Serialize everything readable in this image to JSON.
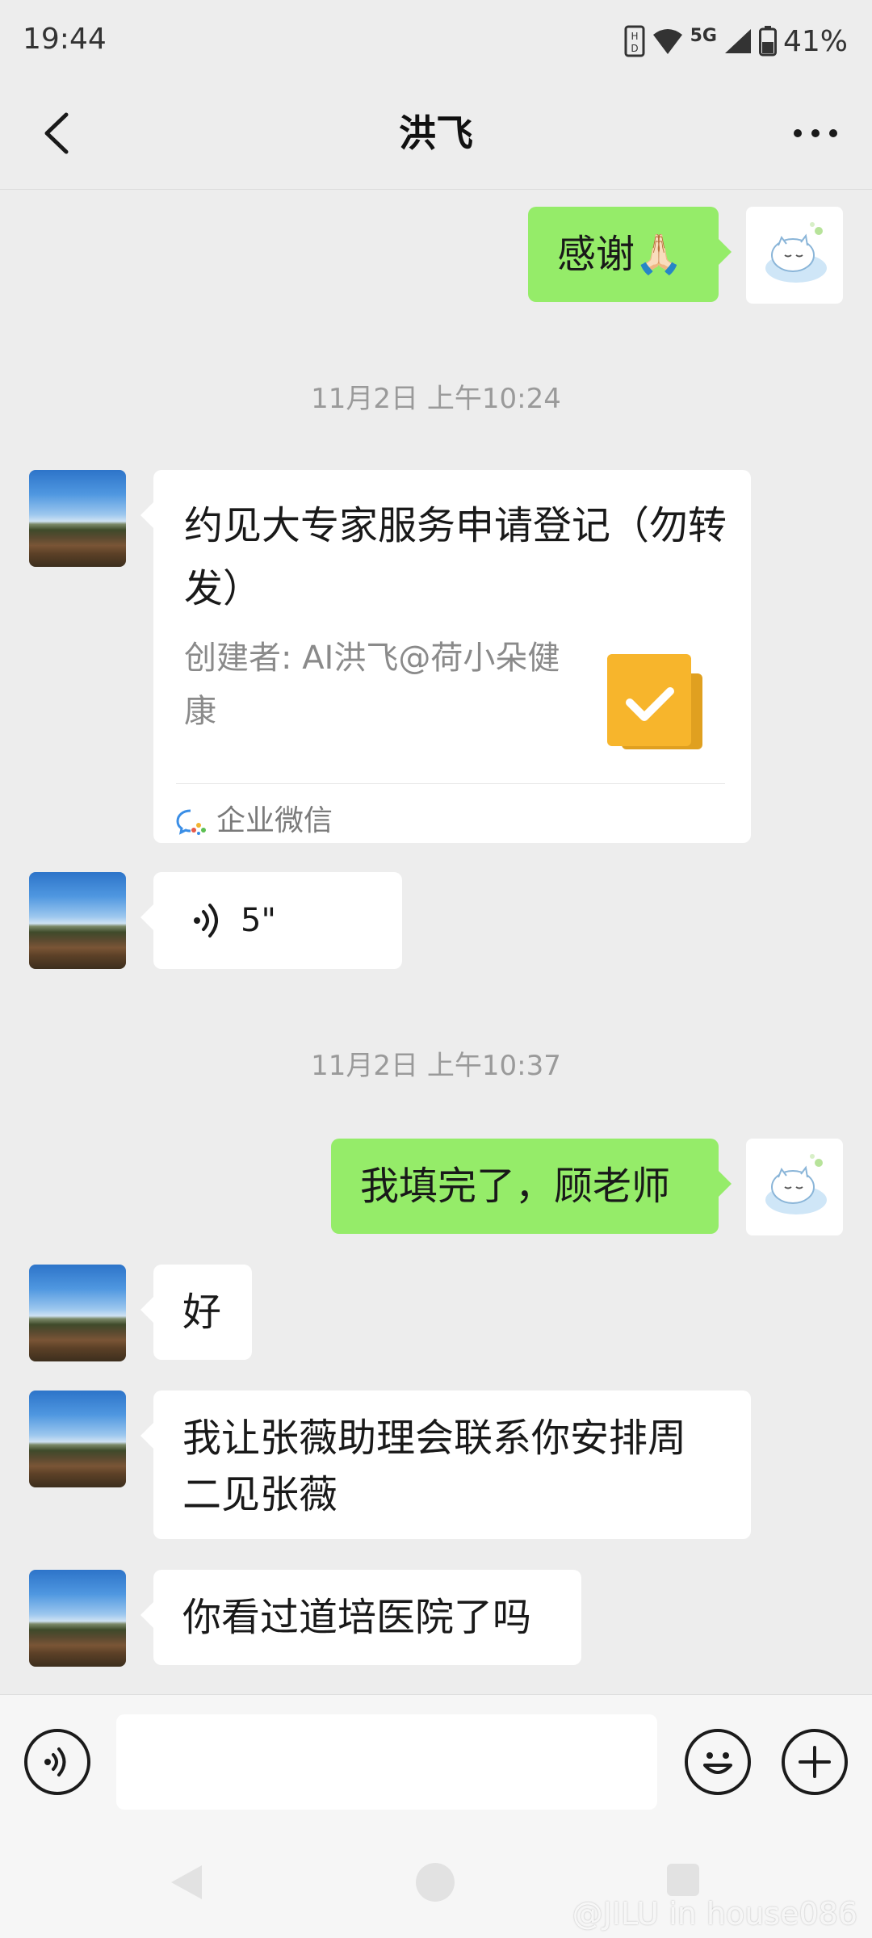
{
  "status_bar": {
    "time": "19:44",
    "network": "5G",
    "battery": "41%"
  },
  "nav": {
    "title": "洪飞"
  },
  "messages": {
    "m1_text": "感谢🙏🏻",
    "time1": "11月2日 上午10:24",
    "card": {
      "title": "约见大专家服务申请登记（勿转发）",
      "creator": "创建者: AI洪飞@荷小朵健康",
      "source": "企业微信"
    },
    "voice_duration": "5\"",
    "time2": "11月2日 上午10:37",
    "m4_text": "我填完了，顾老师",
    "m5_text": "好",
    "m6_text": "我让张薇助理会联系你安排周二见张薇",
    "m7_text": "你看过道培医院了吗"
  },
  "input": {
    "placeholder": ""
  },
  "watermark": "@JILU in house086",
  "colors": {
    "background": "#ededed",
    "outgoing_bubble": "#95ec69",
    "incoming_bubble": "#ffffff",
    "card_icon": "#f7b52c"
  }
}
